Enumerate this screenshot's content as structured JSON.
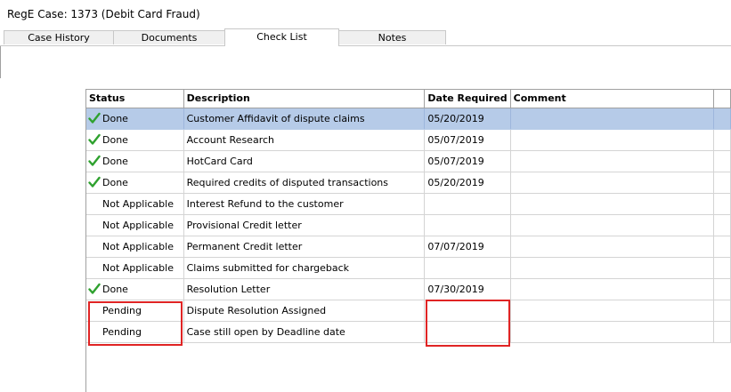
{
  "window": {
    "title": "RegE Case: 1373 (Debit Card Fraud)"
  },
  "tabs": [
    {
      "label": "Case History",
      "active": false
    },
    {
      "label": "Documents",
      "active": false
    },
    {
      "label": "Check List",
      "active": true
    },
    {
      "label": "Notes",
      "active": false
    }
  ],
  "grid": {
    "columns": [
      "Status",
      "Description",
      "Date Required",
      "Comment"
    ],
    "rows": [
      {
        "status": "Done",
        "icon": "checkmark-icon",
        "description": "Customer Affidavit of dispute claims",
        "date": "05/20/2019",
        "comment": "",
        "selected": true
      },
      {
        "status": "Done",
        "icon": "checkmark-icon",
        "description": "Account Research",
        "date": "05/07/2019",
        "comment": ""
      },
      {
        "status": "Done",
        "icon": "checkmark-icon",
        "description": "HotCard Card",
        "date": "05/07/2019",
        "comment": ""
      },
      {
        "status": "Done",
        "icon": "checkmark-icon",
        "description": "Required credits of disputed transactions",
        "date": "05/20/2019",
        "comment": ""
      },
      {
        "status": "Not Applicable",
        "icon": "",
        "description": "Interest Refund to the customer",
        "date": "",
        "comment": ""
      },
      {
        "status": "Not Applicable",
        "icon": "",
        "description": "Provisional Credit letter",
        "date": "",
        "comment": ""
      },
      {
        "status": "Not Applicable",
        "icon": "",
        "description": "Permanent Credit letter",
        "date": "07/07/2019",
        "comment": ""
      },
      {
        "status": "Not Applicable",
        "icon": "",
        "description": "Claims submitted for chargeback",
        "date": "",
        "comment": ""
      },
      {
        "status": "Done",
        "icon": "checkmark-icon",
        "description": "Resolution Letter",
        "date": "07/30/2019",
        "comment": ""
      },
      {
        "status": "Pending",
        "icon": "",
        "description": "Dispute Resolution Assigned",
        "date": "",
        "comment": ""
      },
      {
        "status": "Pending",
        "icon": "",
        "description": "Case still open by Deadline date",
        "date": "",
        "comment": ""
      }
    ]
  },
  "colors": {
    "selected_row": "#b6cbe8",
    "check_green": "#2ea12e",
    "highlight_box": "#e02424"
  }
}
